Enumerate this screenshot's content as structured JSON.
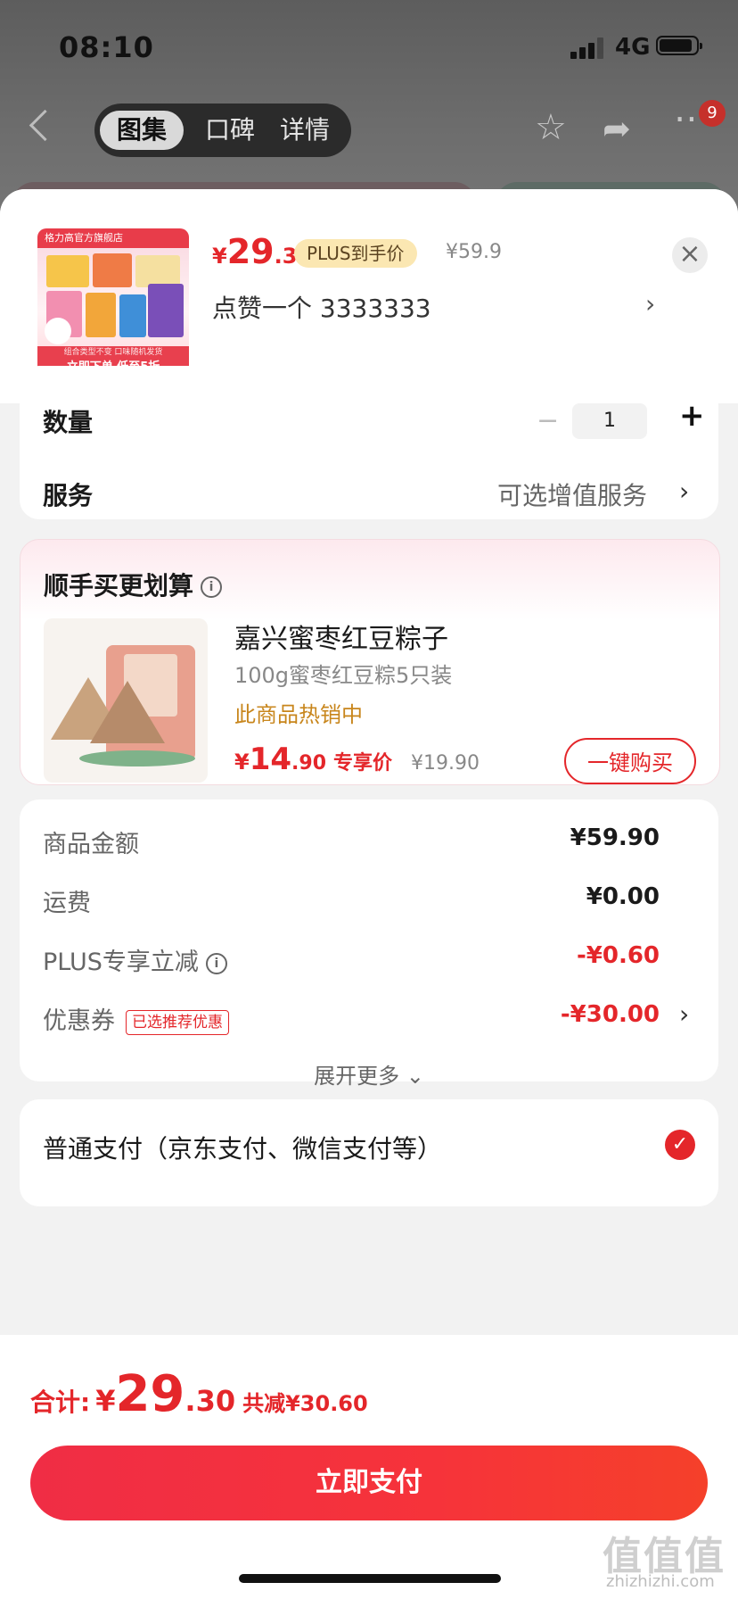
{
  "status": {
    "time": "08:10",
    "network": "4G"
  },
  "nav": {
    "tabs": [
      "图集",
      "口碑",
      "详情"
    ],
    "active_tab": "图集",
    "cart_badge": "9"
  },
  "product": {
    "price_symbol": "¥",
    "price_int": "29",
    "price_dec": ".3",
    "plus_tag": "PLUS到手价",
    "original_price": "¥59.9",
    "like_text": "点赞一个  3333333",
    "thumb_brand": "格力高官方旗舰店",
    "thumb_banner_small": "组合类型不变 口味随机发货",
    "thumb_banner_main": "立即下单 低至5折"
  },
  "quantity": {
    "label": "数量",
    "value": "1",
    "minus": "−",
    "plus": "+"
  },
  "service": {
    "label": "服务",
    "value": "可选增值服务"
  },
  "upsell": {
    "title": "顺手买更划算",
    "name": "嘉兴蜜枣红豆粽子",
    "spec": "100g蜜枣红豆粽5只装",
    "hot": "此商品热销中",
    "price_symbol": "¥",
    "price_int": "14",
    "price_dec": ".90",
    "price_label": "专享价",
    "original_price": "¥19.90",
    "buy_button": "一键购买"
  },
  "summary": {
    "rows": [
      {
        "label": "商品金额",
        "value": "¥59.90"
      },
      {
        "label": "运费",
        "value": "¥0.00"
      },
      {
        "label": "PLUS专享立减",
        "value": "-¥0.60"
      },
      {
        "label": "优惠券",
        "tag": "已选推荐优惠",
        "value": "-¥30.00"
      }
    ],
    "expand": "展开更多"
  },
  "payment": {
    "method": "普通支付（京东支付、微信支付等）"
  },
  "footer": {
    "total_label": "合计:",
    "total_symbol": "¥",
    "total_int": "29",
    "total_dec": ".30",
    "total_reduce": "共减¥30.60",
    "pay_button": "立即支付"
  },
  "watermark": {
    "main": "值值值",
    "sub": "zhizhizhi.com"
  },
  "colors": {
    "accent": "#e4262a",
    "plus_tag_bg": "#fbe7b2",
    "hot_text": "#c8861c"
  }
}
